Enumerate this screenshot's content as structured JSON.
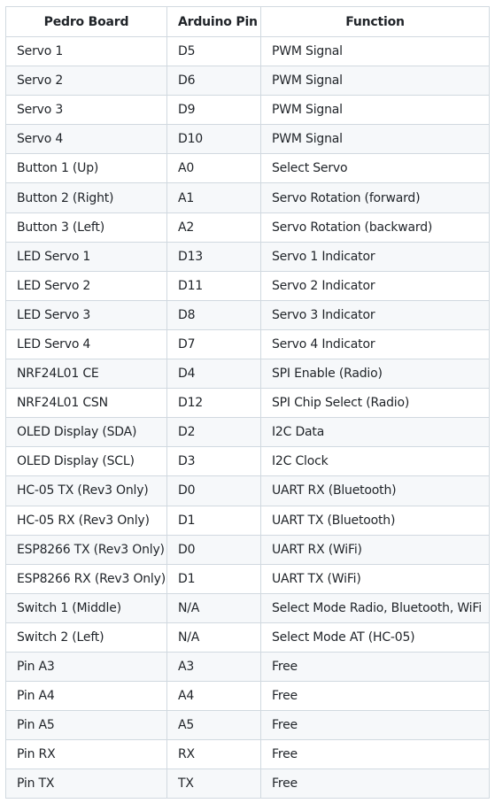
{
  "table": {
    "headers": [
      "Pedro Board",
      "Arduino Pin",
      "Function"
    ],
    "rows": [
      [
        "Servo 1",
        "D5",
        "PWM Signal"
      ],
      [
        "Servo 2",
        "D6",
        "PWM Signal"
      ],
      [
        "Servo 3",
        "D9",
        "PWM Signal"
      ],
      [
        "Servo 4",
        "D10",
        "PWM Signal"
      ],
      [
        "Button 1 (Up)",
        "A0",
        "Select Servo"
      ],
      [
        "Button 2 (Right)",
        "A1",
        "Servo Rotation (forward)"
      ],
      [
        "Button 3 (Left)",
        "A2",
        "Servo Rotation (backward)"
      ],
      [
        "LED Servo 1",
        "D13",
        "Servo 1 Indicator"
      ],
      [
        "LED Servo 2",
        "D11",
        "Servo 2 Indicator"
      ],
      [
        "LED Servo 3",
        "D8",
        "Servo 3 Indicator"
      ],
      [
        "LED Servo 4",
        "D7",
        "Servo 4 Indicator"
      ],
      [
        "NRF24L01 CE",
        "D4",
        "SPI Enable (Radio)"
      ],
      [
        "NRF24L01 CSN",
        "D12",
        "SPI Chip Select (Radio)"
      ],
      [
        "OLED Display (SDA)",
        "D2",
        "I2C Data"
      ],
      [
        "OLED Display (SCL)",
        "D3",
        "I2C Clock"
      ],
      [
        "HC-05 TX (Rev3 Only)",
        "D0",
        "UART RX (Bluetooth)"
      ],
      [
        "HC-05 RX (Rev3 Only)",
        "D1",
        "UART TX (Bluetooth)"
      ],
      [
        "ESP8266 TX (Rev3 Only)",
        "D0",
        "UART RX (WiFi)"
      ],
      [
        "ESP8266 RX (Rev3 Only)",
        "D1",
        "UART TX (WiFi)"
      ],
      [
        "Switch 1 (Middle)",
        "N/A",
        "Select Mode Radio, Bluetooth, WiFi"
      ],
      [
        "Switch 2 (Left)",
        "N/A",
        "Select Mode AT (HC-05)"
      ],
      [
        "Pin A3",
        "A3",
        "Free"
      ],
      [
        "Pin A4",
        "A4",
        "Free"
      ],
      [
        "Pin A5",
        "A5",
        "Free"
      ],
      [
        "Pin RX",
        "RX",
        "Free"
      ],
      [
        "Pin TX",
        "TX",
        "Free"
      ]
    ]
  }
}
